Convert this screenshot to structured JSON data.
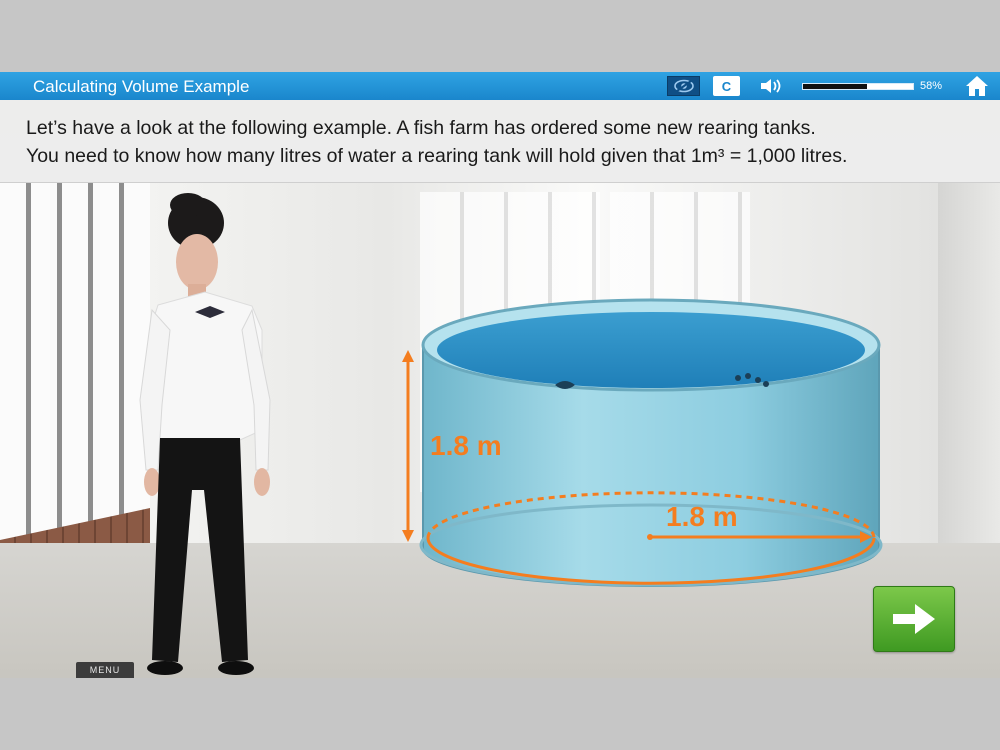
{
  "header": {
    "title": "Calculating Volume Example",
    "reset_label": "C",
    "progress_percent": 58,
    "progress_label": "58%"
  },
  "instruction": {
    "line1": "Let’s have a look at the following example. A fish farm has ordered some new rearing tanks.",
    "line2": "You need to know how many litres of water a rearing tank will hold given that 1m³ = 1,000 litres."
  },
  "diagram": {
    "height_label": "1.8 m",
    "diameter_label": "1.8 m"
  },
  "footer": {
    "menu_label": "MENU"
  },
  "colors": {
    "header_blue": "#1a86cc",
    "annotation_orange": "#f47d1f",
    "next_green": "#4fa82c",
    "tank_blue": "#8fd2e4"
  },
  "icons": {
    "accessibility": "eye-icon",
    "audio": "speaker-icon",
    "home": "home-icon",
    "next": "arrow-right-icon"
  }
}
